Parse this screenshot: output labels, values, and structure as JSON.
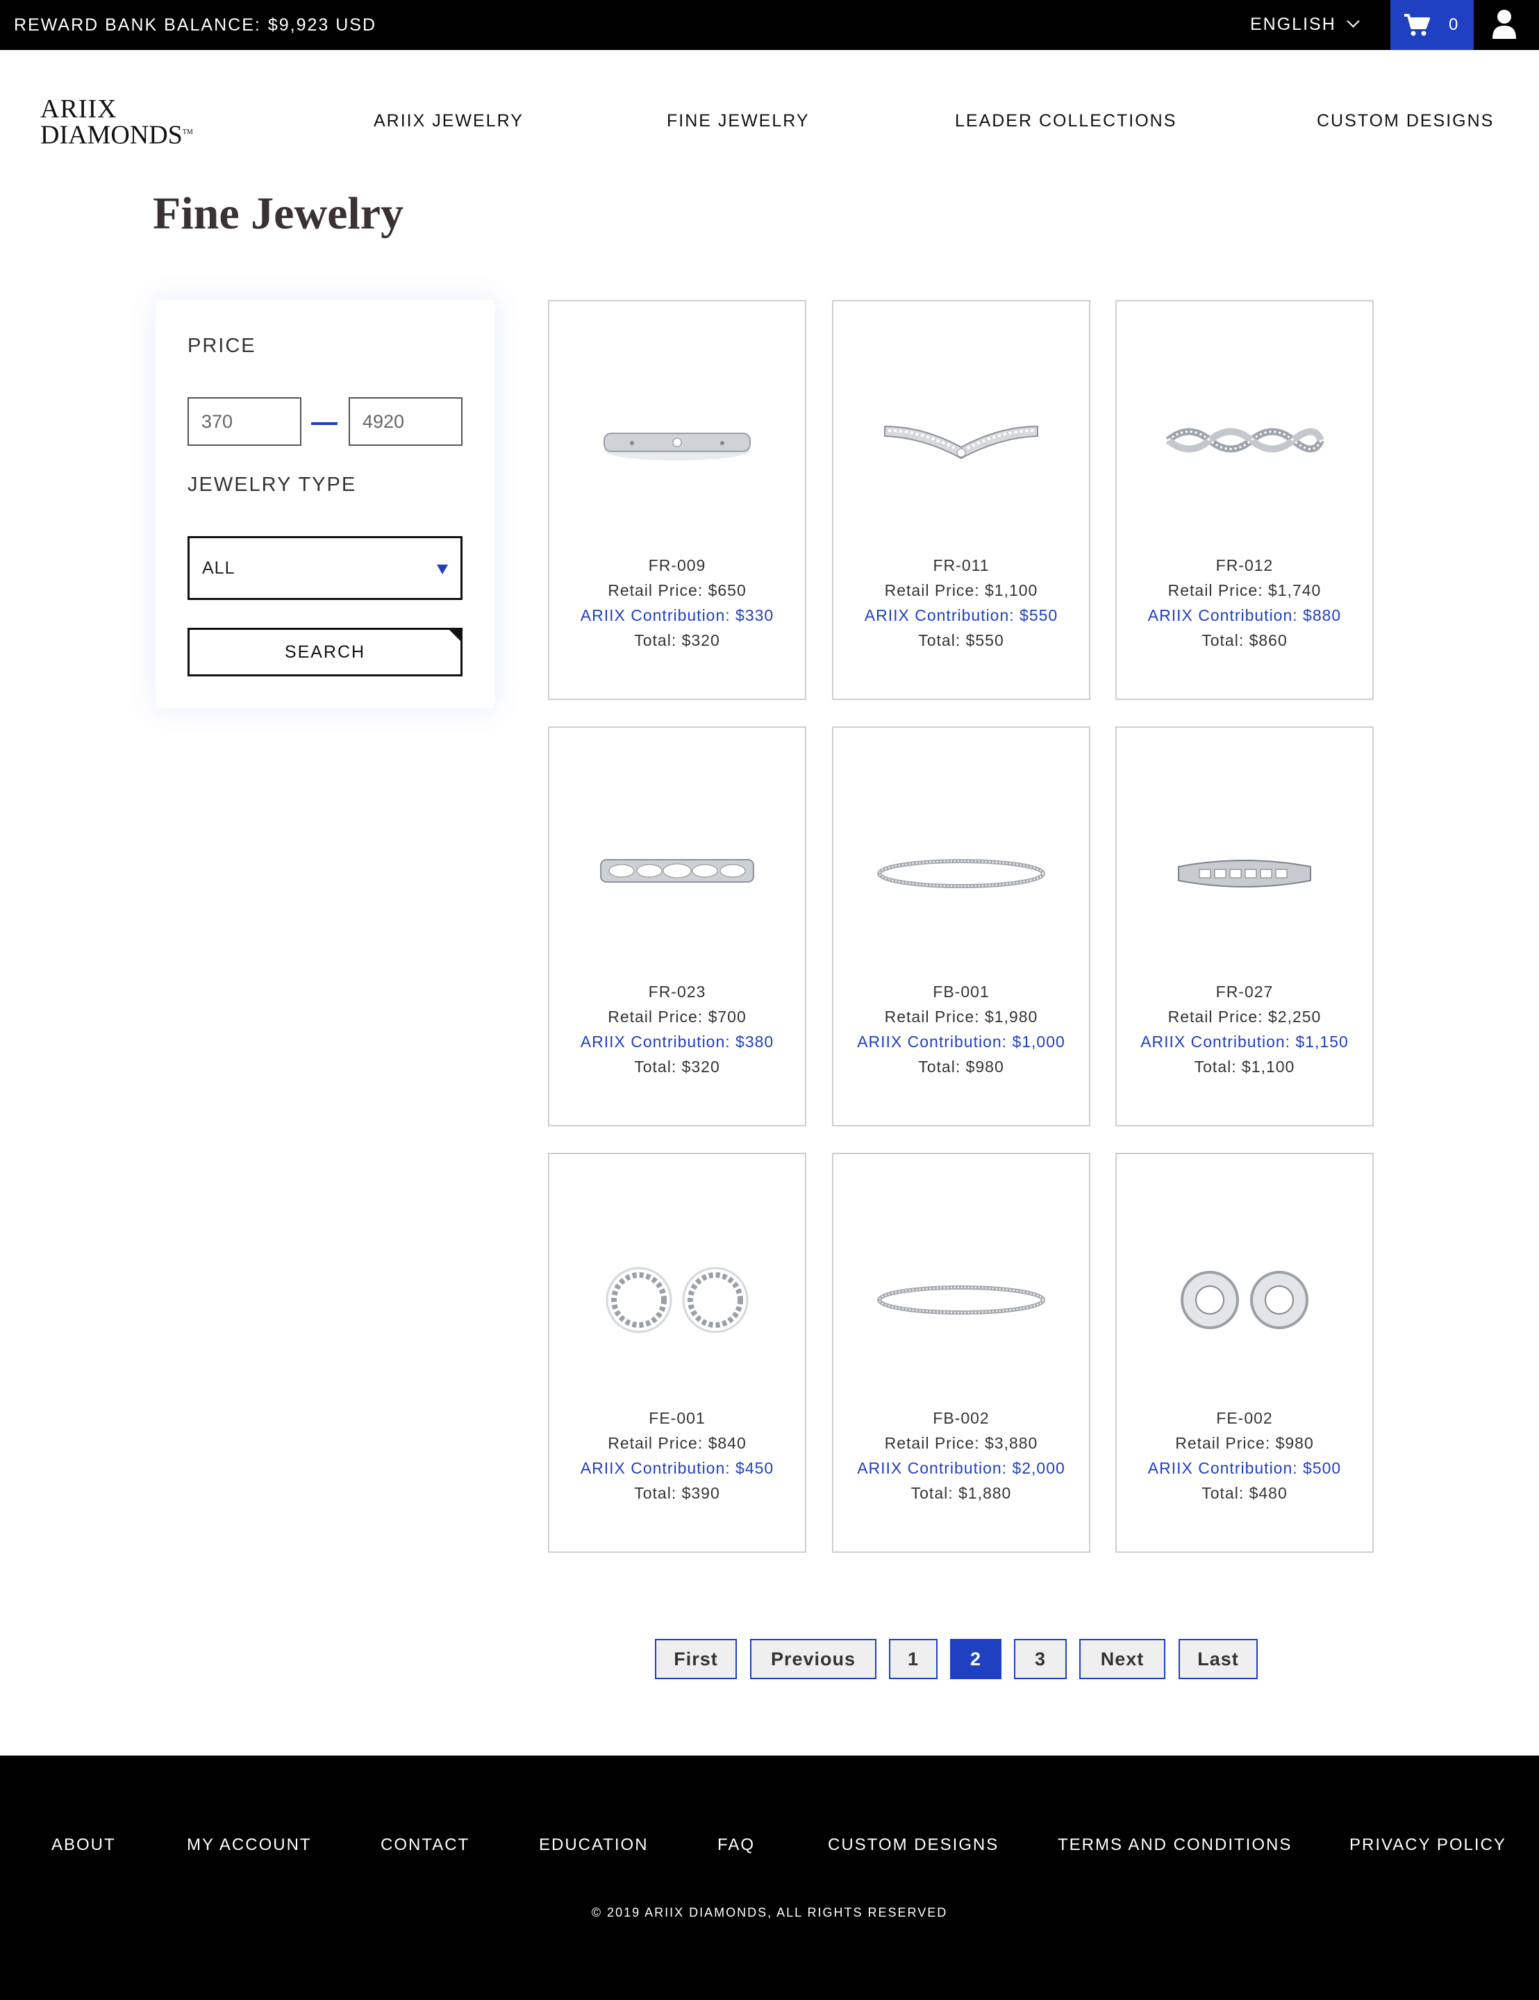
{
  "topbar": {
    "balance_label": "REWARD BANK BALANCE:",
    "balance_value": "$9,923 USD",
    "language": "ENGLISH",
    "cart_count": "0",
    "accent_color": "#1f40c1"
  },
  "header": {
    "logo_line1": "ARIIX",
    "logo_line2": "DIAMONDS",
    "logo_tm": "TM",
    "nav": [
      "ARIIX JEWELRY",
      "FINE JEWELRY",
      "LEADER COLLECTIONS",
      "CUSTOM DESIGNS"
    ]
  },
  "page_title": "Fine Jewelry",
  "filter": {
    "price_label": "PRICE",
    "price_min": "370",
    "price_max": "4920",
    "type_label": "JEWELRY TYPE",
    "type_selected": "ALL",
    "search_label": "SEARCH"
  },
  "products": [
    {
      "code": "FR-009",
      "retail": "Retail Price: $650",
      "contrib": "ARIIX Contribution: $330",
      "total": "Total: $320",
      "image": "plain-band-ring"
    },
    {
      "code": "FR-011",
      "retail": "Retail Price: $1,100",
      "contrib": "ARIIX Contribution: $550",
      "total": "Total: $550",
      "image": "curved-diamond-band"
    },
    {
      "code": "FR-012",
      "retail": "Retail Price: $1,740",
      "contrib": "ARIIX Contribution: $880",
      "total": "Total: $860",
      "image": "twisted-diamond-band"
    },
    {
      "code": "FR-023",
      "retail": "Retail Price: $700",
      "contrib": "ARIIX Contribution: $380",
      "total": "Total: $320",
      "image": "marquise-pattern-band"
    },
    {
      "code": "FB-001",
      "retail": "Retail Price: $1,980",
      "contrib": "ARIIX Contribution: $1,000",
      "total": "Total: $980",
      "image": "tennis-bracelet"
    },
    {
      "code": "FR-027",
      "retail": "Retail Price: $2,250",
      "contrib": "ARIIX Contribution: $1,150",
      "total": "Total: $1,100",
      "image": "baguette-band"
    },
    {
      "code": "FE-001",
      "retail": "Retail Price: $840",
      "contrib": "ARIIX Contribution: $450",
      "total": "Total: $390",
      "image": "starburst-earrings"
    },
    {
      "code": "FB-002",
      "retail": "Retail Price: $3,880",
      "contrib": "ARIIX Contribution: $2,000",
      "total": "Total: $1,880",
      "image": "tennis-bracelet"
    },
    {
      "code": "FE-002",
      "retail": "Retail Price: $980",
      "contrib": "ARIIX Contribution: $500",
      "total": "Total: $480",
      "image": "halo-stud-earrings"
    }
  ],
  "pagination": {
    "first": "First",
    "previous": "Previous",
    "pages": [
      "1",
      "2",
      "3"
    ],
    "current": "2",
    "next": "Next",
    "last": "Last"
  },
  "footer": {
    "links": [
      "ABOUT",
      "MY ACCOUNT",
      "CONTACT",
      "EDUCATION",
      "FAQ",
      "CUSTOM DESIGNS",
      "TERMS AND CONDITIONS",
      "PRIVACY POLICY"
    ],
    "copyright": "© 2019 ARIIX DIAMONDS,   ALL RIGHTS RESERVED"
  }
}
